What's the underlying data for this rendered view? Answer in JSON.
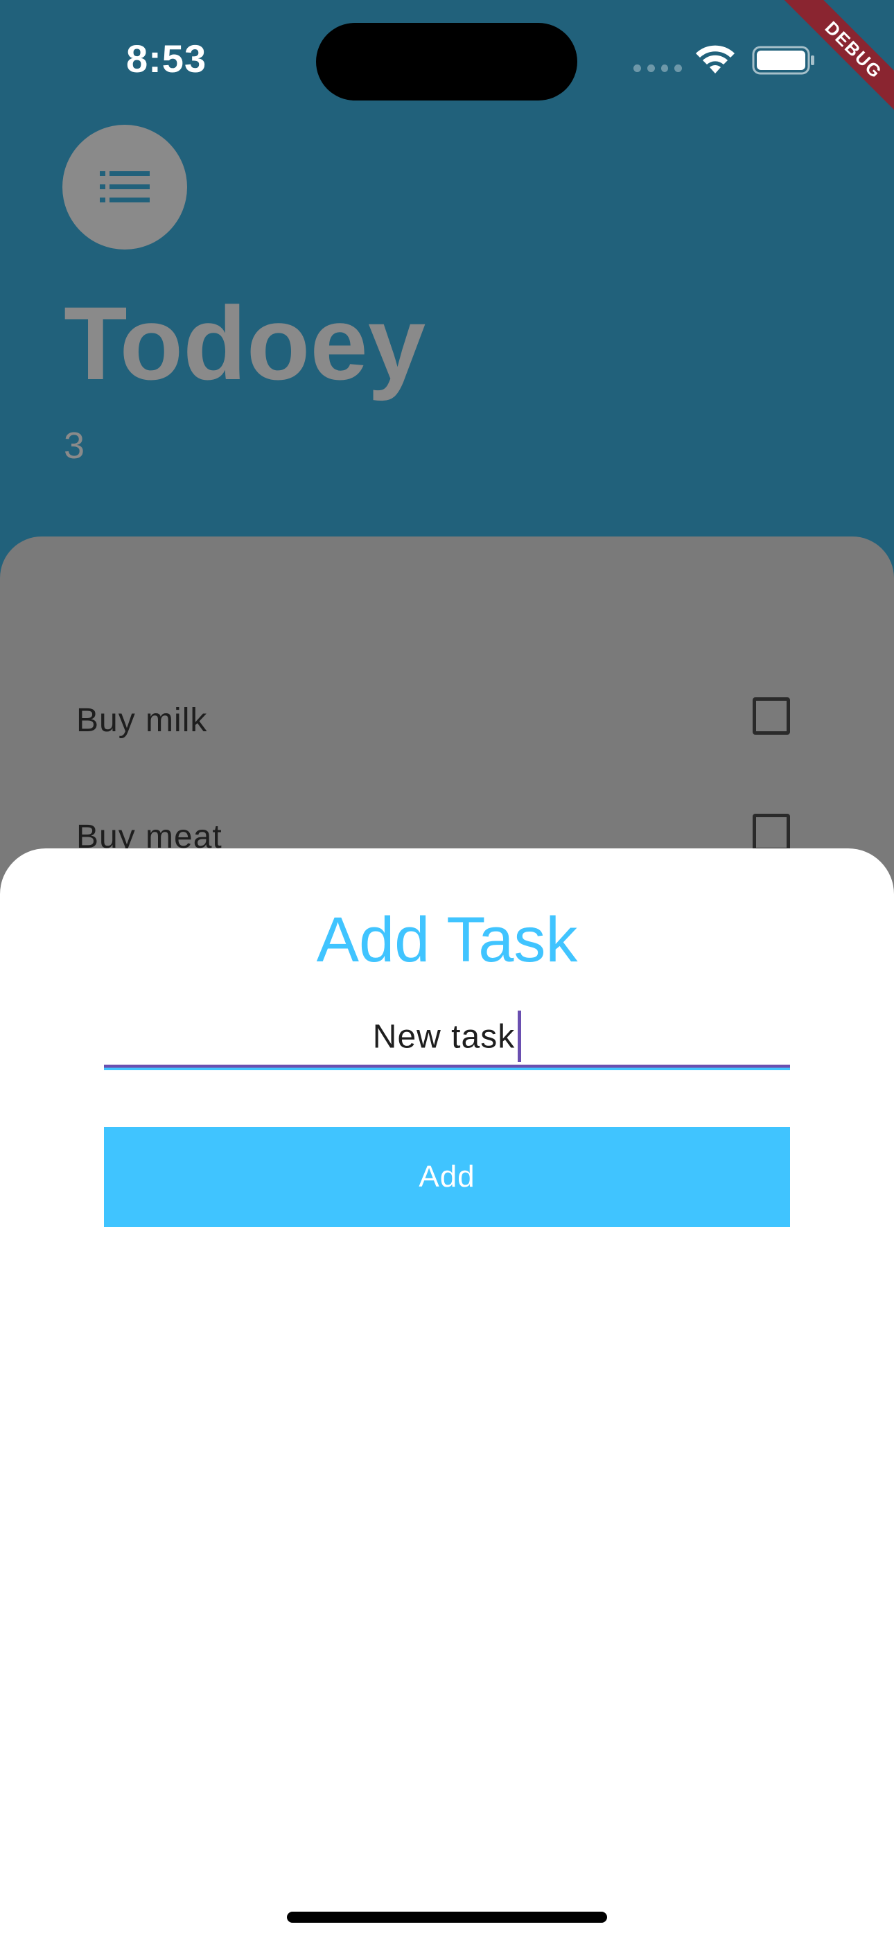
{
  "status_bar": {
    "time": "8:53"
  },
  "debug_banner": "DEBUG",
  "header": {
    "menu_icon": "list-icon",
    "title": "Todoey",
    "task_count": "3"
  },
  "tasks": [
    {
      "label": "Buy milk",
      "checked": false
    },
    {
      "label": "Buy meat",
      "checked": false
    }
  ],
  "add_task_sheet": {
    "title": "Add Task",
    "input_value": "New task",
    "button_label": "Add"
  },
  "colors": {
    "accent": "#40c4ff",
    "background": "#21617b",
    "cursor": "#6a4fb0"
  }
}
